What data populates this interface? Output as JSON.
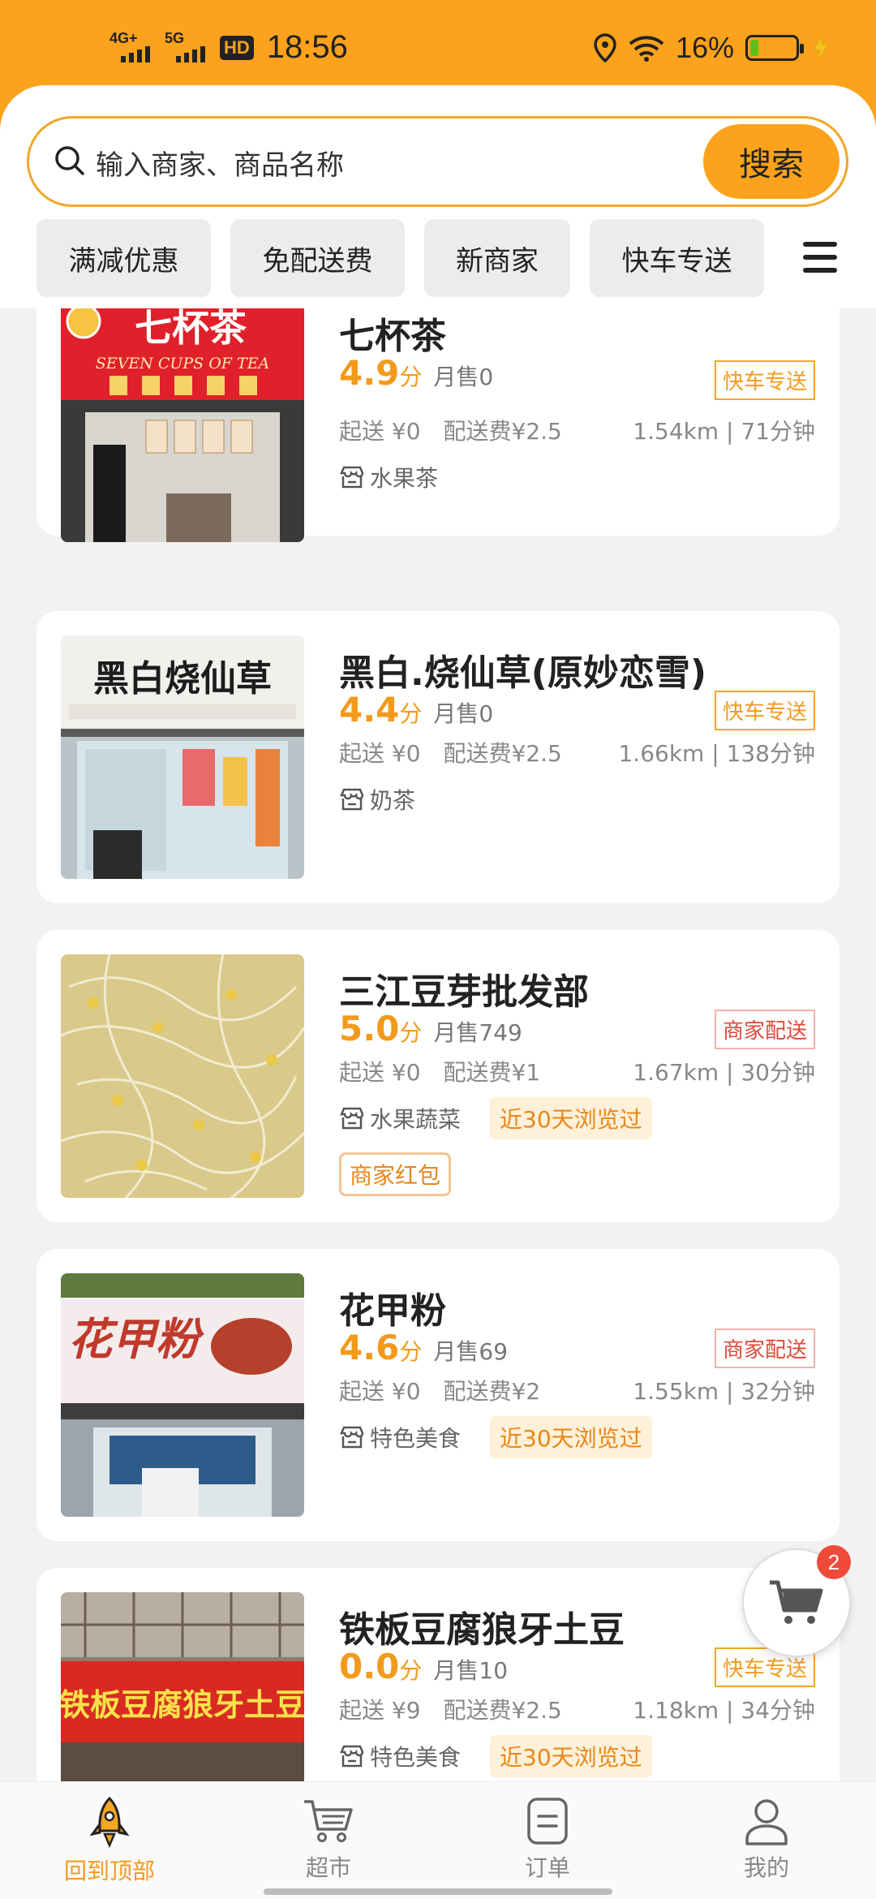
{
  "status_bar": {
    "net1": "4G+",
    "net2": "5G",
    "hd": "HD",
    "time": "18:56",
    "battery": "16%"
  },
  "search": {
    "placeholder": "输入商家、商品名称",
    "button": "搜索"
  },
  "filters": [
    "满减优惠",
    "免配送费",
    "新商家",
    "快车专送"
  ],
  "stores": [
    {
      "name": "七杯茶",
      "score": "4.9",
      "score_unit": "分",
      "monthly": "月售0",
      "delivery_tag": "快车专送",
      "min_order": "起送 ¥0",
      "delivery_fee": "配送费¥2.5",
      "distance": "1.54km | 71分钟",
      "category": "水果茶",
      "sign_text": "七杯茶",
      "sign_sub": "SEVEN CUPS OF TEA"
    },
    {
      "name": "黑白.烧仙草(原妙恋雪)",
      "score": "4.4",
      "score_unit": "分",
      "monthly": "月售0",
      "delivery_tag": "快车专送",
      "min_order": "起送 ¥0",
      "delivery_fee": "配送费¥2.5",
      "distance": "1.66km | 138分钟",
      "category": "奶茶",
      "sign_text": "黑白烧仙草"
    },
    {
      "name": "三江豆芽批发部",
      "score": "5.0",
      "score_unit": "分",
      "monthly": "月售749",
      "delivery_tag": "商家配送",
      "min_order": "起送 ¥0",
      "delivery_fee": "配送费¥1",
      "distance": "1.67km | 30分钟",
      "category": "水果蔬菜",
      "recent": "近30天浏览过",
      "promo": "商家红包"
    },
    {
      "name": "花甲粉",
      "score": "4.6",
      "score_unit": "分",
      "monthly": "月售69",
      "delivery_tag": "商家配送",
      "min_order": "起送 ¥0",
      "delivery_fee": "配送费¥2",
      "distance": "1.55km | 32分钟",
      "category": "特色美食",
      "recent": "近30天浏览过",
      "sign_text": "花甲粉"
    },
    {
      "name": "铁板豆腐狼牙土豆",
      "score": "0.0",
      "score_unit": "分",
      "monthly": "月售10",
      "delivery_tag": "快车专送",
      "min_order": "起送 ¥9",
      "delivery_fee": "配送费¥2.5",
      "distance": "1.18km | 34分钟",
      "category": "特色美食",
      "recent": "近30天浏览过",
      "sign_text": "铁板豆腐狼牙土豆"
    }
  ],
  "cart": {
    "count": "2"
  },
  "bottom_nav": [
    {
      "label": "回到顶部",
      "icon": "rocket-icon"
    },
    {
      "label": "超市",
      "icon": "cart-icon"
    },
    {
      "label": "订单",
      "icon": "order-icon"
    },
    {
      "label": "我的",
      "icon": "user-icon"
    }
  ],
  "colors": {
    "accent": "#fca21c",
    "score": "#f39a1c",
    "merchant_tag": "#e04a3a"
  }
}
